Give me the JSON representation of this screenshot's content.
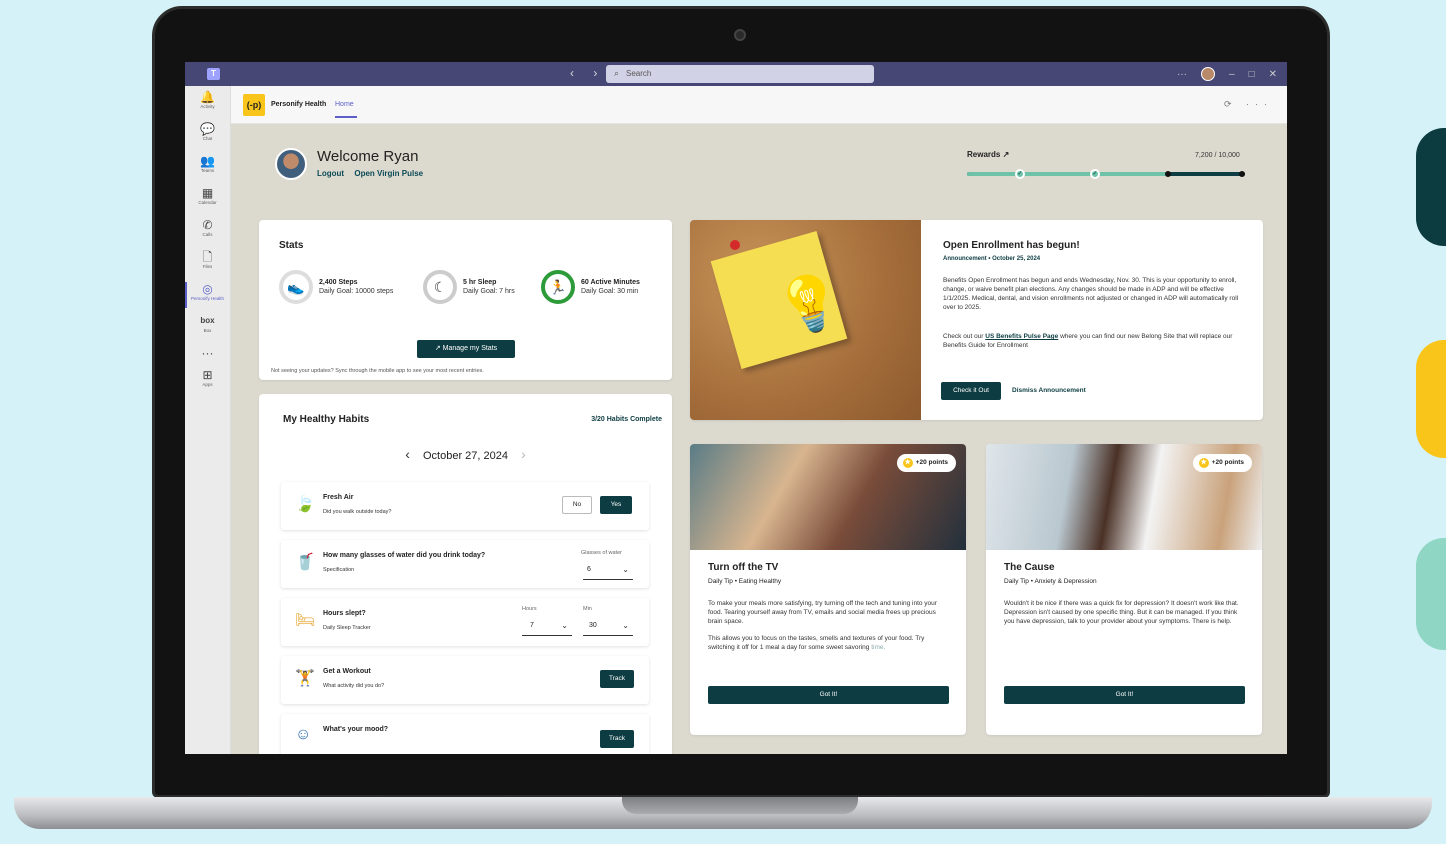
{
  "titlebar": {
    "app_icon": "teams-icon",
    "search_placeholder": "Search",
    "more": "···",
    "window_controls": [
      "–",
      "□",
      "✕"
    ]
  },
  "rail": [
    {
      "label": "Activity",
      "icon": "bell-icon",
      "glyph": "🔔"
    },
    {
      "label": "Chat",
      "icon": "chat-icon",
      "glyph": "💬"
    },
    {
      "label": "Teams",
      "icon": "teams-group-icon",
      "glyph": "👥"
    },
    {
      "label": "Calendar",
      "icon": "calendar-icon",
      "glyph": "▦"
    },
    {
      "label": "Calls",
      "icon": "phone-icon",
      "glyph": "✆"
    },
    {
      "label": "Files",
      "icon": "file-icon",
      "glyph": "🗋"
    },
    {
      "label": "Personify Health",
      "icon": "personify-icon",
      "glyph": "◎"
    },
    {
      "label": "Box",
      "icon": "box-icon",
      "glyph": "box"
    },
    {
      "label": "",
      "icon": "more-icon",
      "glyph": "···"
    },
    {
      "label": "Apps",
      "icon": "add-apps-icon",
      "glyph": "⊞"
    }
  ],
  "app_header": {
    "logo_text": "(-p)",
    "app_name": "Personify Health",
    "tab": "Home",
    "icons": "⟳ ···"
  },
  "welcome": {
    "title": "Welcome Ryan",
    "logout": "Logout",
    "open_link": "Open Virgin Pulse"
  },
  "rewards": {
    "label": "Rewards",
    "value": "7,200 / 10,000",
    "progress": 0.72
  },
  "stats": {
    "title": "Stats",
    "items": [
      {
        "title": "2,400 Steps",
        "sub": "Daily Goal: 10000 steps",
        "icon": "shoe-icon"
      },
      {
        "title": "5 hr Sleep",
        "sub": "Daily Goal: 7 hrs",
        "icon": "moon-icon"
      },
      {
        "title": "60 Active Minutes",
        "sub": "Daily Goal: 30 min",
        "icon": "running-icon"
      }
    ],
    "manage_button": "Manage my Stats",
    "note": "Not seeing your updates? Sync through the mobile app to see your most recent entries."
  },
  "habits": {
    "title": "My Healthy Habits",
    "complete": "3/20 Habits Complete",
    "date": "October 27, 2024",
    "items": [
      {
        "title": "Fresh Air",
        "sub": "Did you walk outside today?",
        "no": "No",
        "yes": "Yes"
      },
      {
        "title": "How many glasses of water did you drink today?",
        "sub": "Specification",
        "select_label": "Glasses of water",
        "value": "6"
      },
      {
        "title": "Hours slept?",
        "sub": "Daily Sleep Tracker",
        "hours_label": "Hours",
        "hours": "7",
        "min_label": "Min",
        "min": "30"
      },
      {
        "title": "Get a Workout",
        "sub": "What activity did you do?",
        "button": "Track"
      },
      {
        "title": "What's your mood?",
        "sub": "",
        "button": "Track"
      }
    ]
  },
  "announcement": {
    "title": "Open Enrollment has begun!",
    "meta": "Announcement  •  October 25, 2024",
    "body": "Benefits Open Enrollment has begun and ends Wednesday, Nov. 30. This is your opportunity to enroll, change, or waive benefit plan elections. Any changes should be made in ADP and will be effective 1/1/2025. Medical, dental, and vision enrollments not adjusted or changed in ADP will automatically roll over to 2025.",
    "body2_pre": "Check out our ",
    "body2_link": "US Benefits Pulse Page",
    "body2_post": " where you can find our new Belong Site that will replace our Benefits Guide for Enrollment",
    "button": "Check it Out",
    "dismiss": "Dismiss Announcement"
  },
  "tips": [
    {
      "points": "+20 points",
      "title": "Turn off the TV",
      "meta": "Daily Tip  •  Eating Healthy",
      "p1": "To make your meals more satisfying, try turning off the tech and tuning into your food. Tearing yourself away from TV, emails and social media frees up precious brain space.",
      "p2": "This allows you to focus on the tastes, smells and textures of your food. Try switching it off for 1 meal a day for some sweet savoring",
      "p2_fade": "time.",
      "button": "Got It!"
    },
    {
      "points": "+20 points",
      "title": "The Cause",
      "meta": "Daily Tip  •  Anxiety & Depression",
      "p1": "Wouldn't it be nice if there was a quick fix for depression? It doesn't work like that. Depression isn't caused by one specific thing. But it can be managed. If you think you have depression, talk to your provider about your symptoms. There is help.",
      "p2": "",
      "p2_fade": "",
      "button": "Got It!"
    }
  ]
}
